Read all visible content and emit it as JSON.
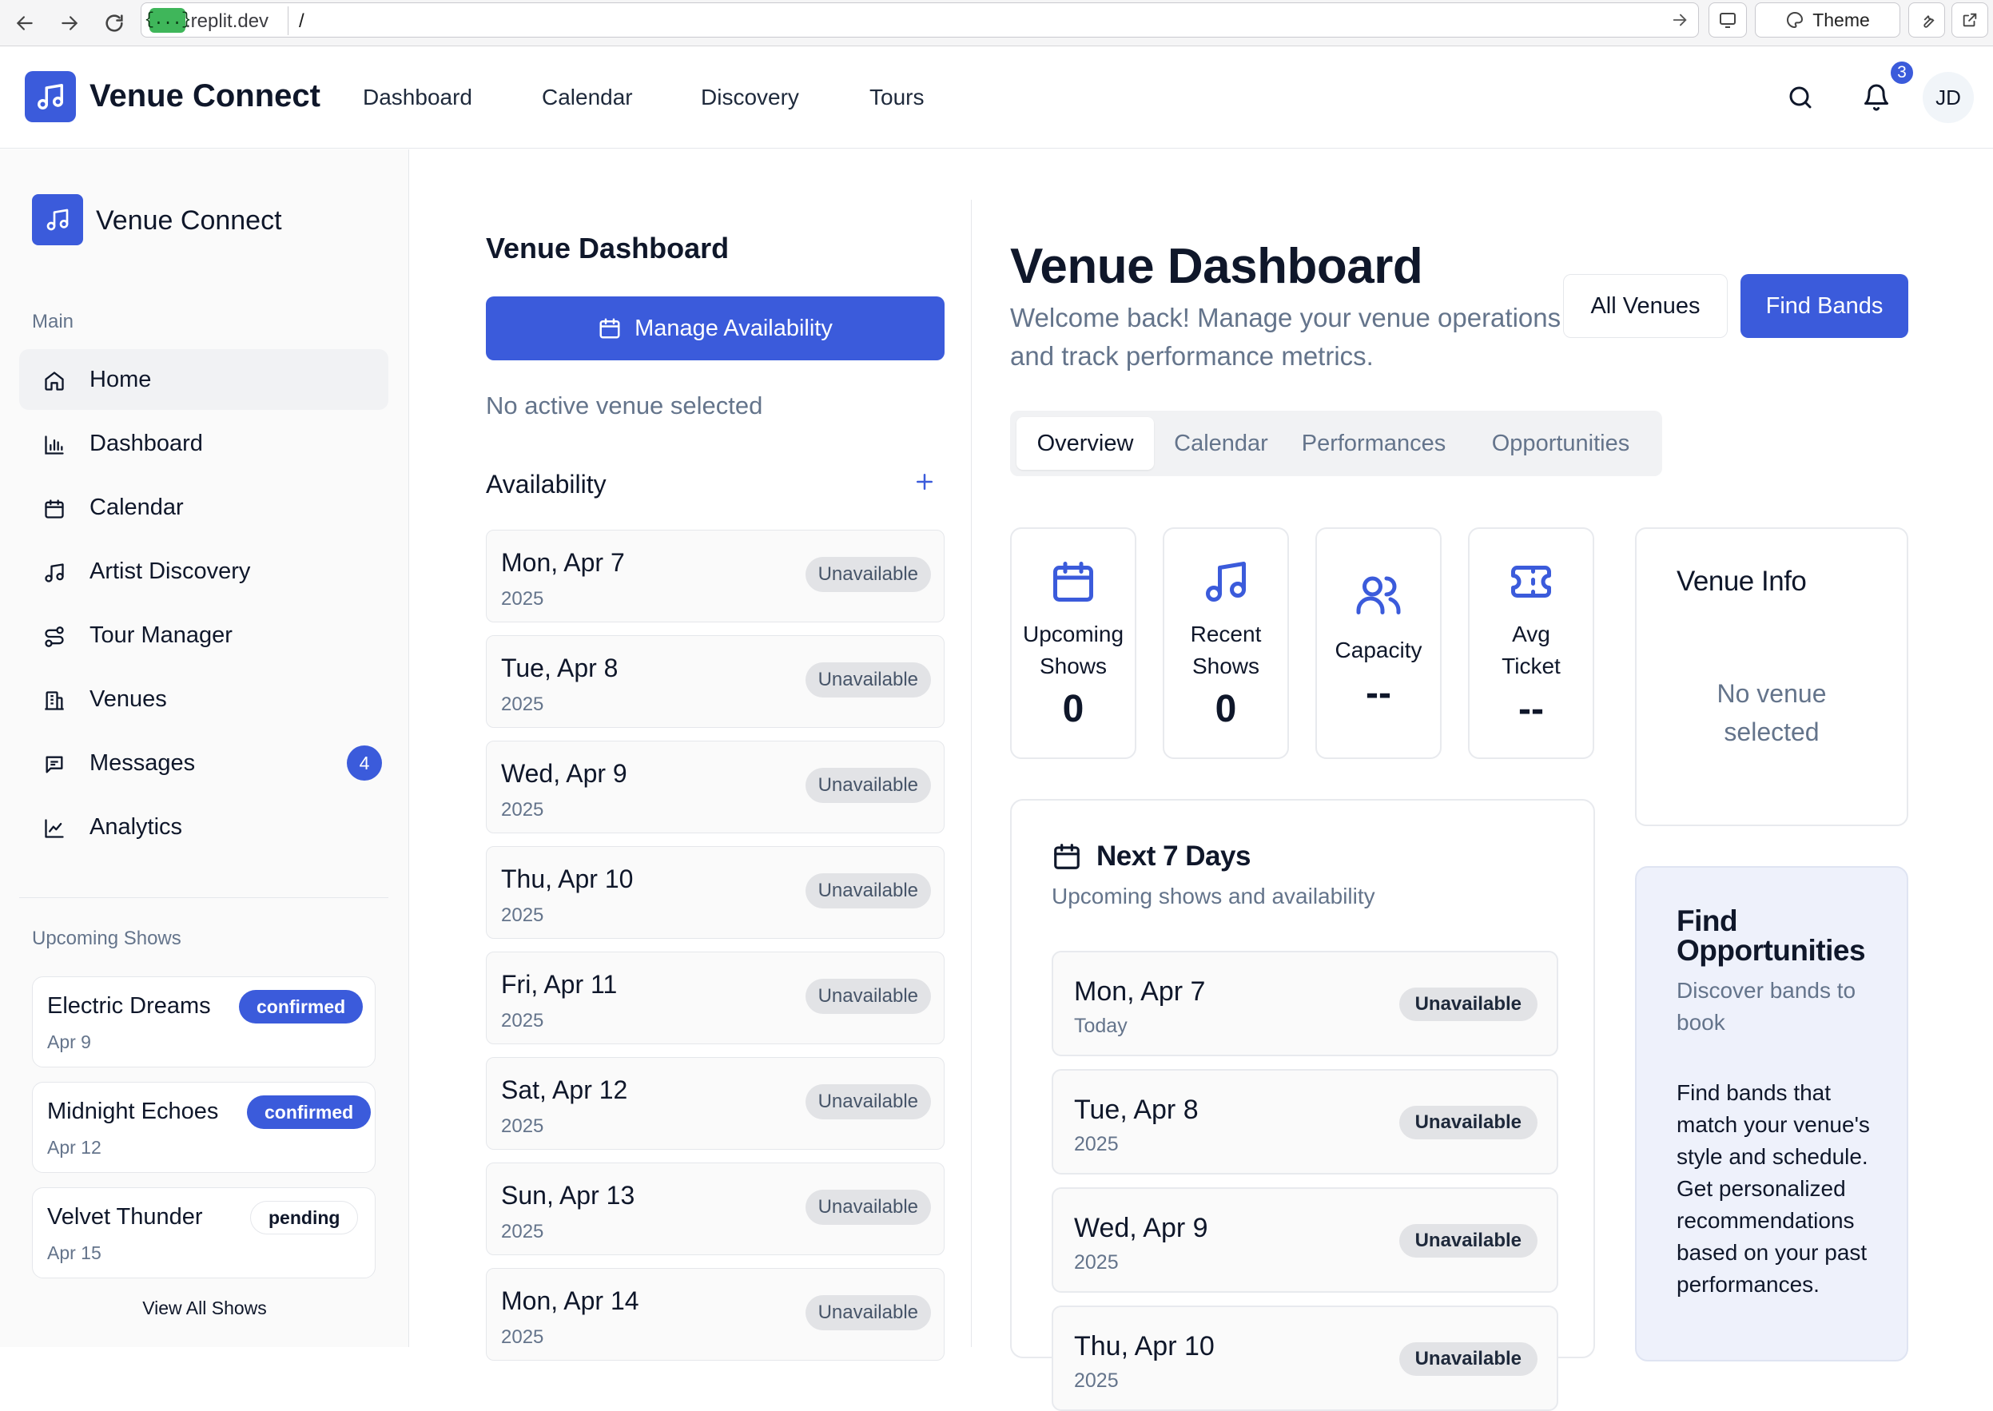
{
  "browser": {
    "favicon_text": "{...}",
    "domain": ".replit.dev",
    "path": "/",
    "theme_label": "Theme"
  },
  "topnav": {
    "brand": "Venue Connect",
    "links": [
      "Dashboard",
      "Calendar",
      "Discovery",
      "Tours"
    ],
    "notification_count": "3",
    "avatar_initials": "JD"
  },
  "sidebar": {
    "brand": "Venue Connect",
    "section_main": "Main",
    "items": [
      {
        "label": "Home",
        "icon": "home-icon"
      },
      {
        "label": "Dashboard",
        "icon": "bar-chart-icon"
      },
      {
        "label": "Calendar",
        "icon": "calendar-icon"
      },
      {
        "label": "Artist Discovery",
        "icon": "music-icon"
      },
      {
        "label": "Tour Manager",
        "icon": "route-icon"
      },
      {
        "label": "Venues",
        "icon": "building-icon"
      },
      {
        "label": "Messages",
        "icon": "message-icon",
        "badge": "4"
      },
      {
        "label": "Analytics",
        "icon": "line-chart-icon"
      }
    ],
    "section_shows": "Upcoming Shows",
    "shows": [
      {
        "name": "Electric Dreams",
        "date": "Apr 9",
        "status": "confirmed"
      },
      {
        "name": "Midnight Echoes",
        "date": "Apr 12",
        "status": "confirmed"
      },
      {
        "name": "Velvet Thunder",
        "date": "Apr 15",
        "status": "pending"
      }
    ],
    "view_all": "View All Shows"
  },
  "middle": {
    "title": "Venue Dashboard",
    "manage_button": "Manage Availability",
    "no_venue": "No active venue selected",
    "availability_title": "Availability",
    "availability": [
      {
        "day": "Mon, Apr 7",
        "year": "2025",
        "status": "Unavailable"
      },
      {
        "day": "Tue, Apr 8",
        "year": "2025",
        "status": "Unavailable"
      },
      {
        "day": "Wed, Apr 9",
        "year": "2025",
        "status": "Unavailable"
      },
      {
        "day": "Thu, Apr 10",
        "year": "2025",
        "status": "Unavailable"
      },
      {
        "day": "Fri, Apr 11",
        "year": "2025",
        "status": "Unavailable"
      },
      {
        "day": "Sat, Apr 12",
        "year": "2025",
        "status": "Unavailable"
      },
      {
        "day": "Sun, Apr 13",
        "year": "2025",
        "status": "Unavailable"
      },
      {
        "day": "Mon, Apr 14",
        "year": "2025",
        "status": "Unavailable"
      }
    ]
  },
  "main": {
    "title": "Venue Dashboard",
    "welcome": "Welcome back! Manage your venue operations and track performance metrics.",
    "all_venues_button": "All Venues",
    "find_bands_button": "Find Bands",
    "tabs": [
      "Overview",
      "Calendar",
      "Performances",
      "Opportunities"
    ],
    "active_tab": "Overview",
    "stats": [
      {
        "label1": "Upcoming",
        "label2": "Shows",
        "value": "0",
        "icon": "calendar-icon"
      },
      {
        "label1": "Recent",
        "label2": "Shows",
        "value": "0",
        "icon": "music-icon"
      },
      {
        "label1": "Capacity",
        "label2": "",
        "value": "--",
        "icon": "users-icon"
      },
      {
        "label1": "Avg",
        "label2": "Ticket",
        "value": "--",
        "icon": "ticket-icon"
      }
    ],
    "venue_info": {
      "title": "Venue Info",
      "message": "No venue selected"
    },
    "next7": {
      "title": "Next 7 Days",
      "subtitle": "Upcoming shows and availability",
      "days": [
        {
          "day": "Mon, Apr 7",
          "sub": "Today",
          "status": "Unavailable"
        },
        {
          "day": "Tue, Apr 8",
          "sub": "2025",
          "status": "Unavailable"
        },
        {
          "day": "Wed, Apr 9",
          "sub": "2025",
          "status": "Unavailable"
        },
        {
          "day": "Thu, Apr 10",
          "sub": "2025",
          "status": "Unavailable"
        }
      ]
    },
    "opportunities": {
      "title": "Find Opportunities",
      "subtitle": "Discover bands to book",
      "body": "Find bands that match your venue's style and schedule. Get personalized recommendations based on your past performances."
    }
  }
}
